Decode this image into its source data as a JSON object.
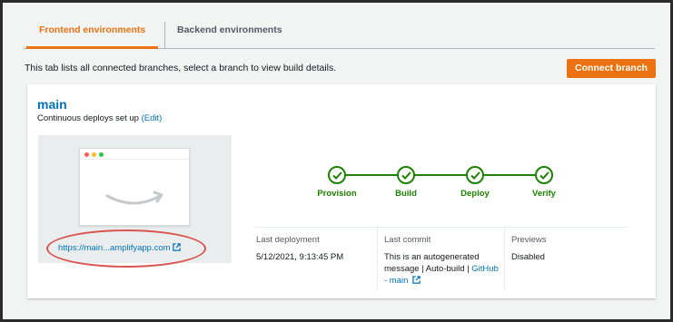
{
  "tabs": [
    {
      "label": "Frontend environments",
      "active": true
    },
    {
      "label": "Backend environments",
      "active": false
    }
  ],
  "info_text": "This tab lists all connected branches, select a branch to view build details.",
  "connect_button": "Connect branch",
  "branch": {
    "name": "main",
    "deploy_text": "Continuous deploys set up",
    "edit_link": "(Edit)",
    "app_url": "https://main...amplifyapp.com",
    "pipeline": [
      "Provision",
      "Build",
      "Deploy",
      "Verify"
    ],
    "last_deployment": {
      "label": "Last deployment",
      "value": "5/12/2021, 9:13:45 PM"
    },
    "last_commit": {
      "label": "Last commit",
      "line1": "This is an autogenerated",
      "line2": "message | Auto-build |",
      "link_part1": "GitHub",
      "link_part2": "- main"
    },
    "previews": {
      "label": "Previews",
      "value": "Disabled"
    }
  },
  "colors": {
    "accent": "#ec7211",
    "link": "#0073bb",
    "success": "#1d8102",
    "highlight": "#d9534f"
  },
  "icons": [
    "external-link-icon",
    "check-icon"
  ]
}
